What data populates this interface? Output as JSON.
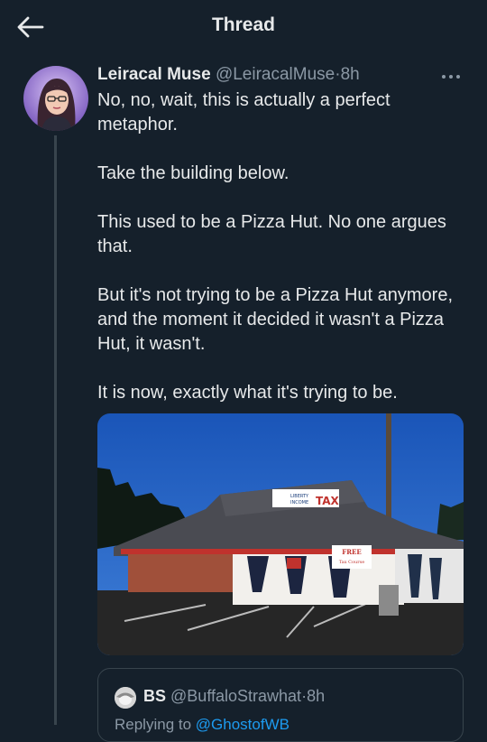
{
  "header": {
    "title": "Thread",
    "back_icon": "arrow-left-icon"
  },
  "tweet": {
    "author_name": "Leiracal Muse",
    "handle": "@LeiracalMuse",
    "separator": "·",
    "time": "8h",
    "more_icon": "more-horizontal-icon",
    "paragraphs": [
      "No, no, wait, this is actually a perfect metaphor.",
      "Take the building below.",
      "This used to be a Pizza Hut. No one argues that.",
      "But it's not trying to be a Pizza Hut anymore, and the moment it decided it wasn't a Pizza Hut, it wasn't.",
      "It is now, exactly what it's trying to be."
    ],
    "image": {
      "sign_top": "LIBERTY",
      "sign_bottom": "INCOME",
      "sign_tax": "TAX",
      "banner_free": "FREE",
      "banner_line2": "Tax Course"
    }
  },
  "quoted": {
    "author_name": "BS",
    "handle": "@BuffaloStrawhat",
    "separator": "·",
    "time": "8h",
    "reply_prefix": "Replying to",
    "reply_handle": "@GhostofWB"
  },
  "colors": {
    "background": "#15202b",
    "text": "#e7e9ea",
    "secondary": "#8b98a5",
    "border": "#38444d",
    "link": "#1d9bf0"
  }
}
